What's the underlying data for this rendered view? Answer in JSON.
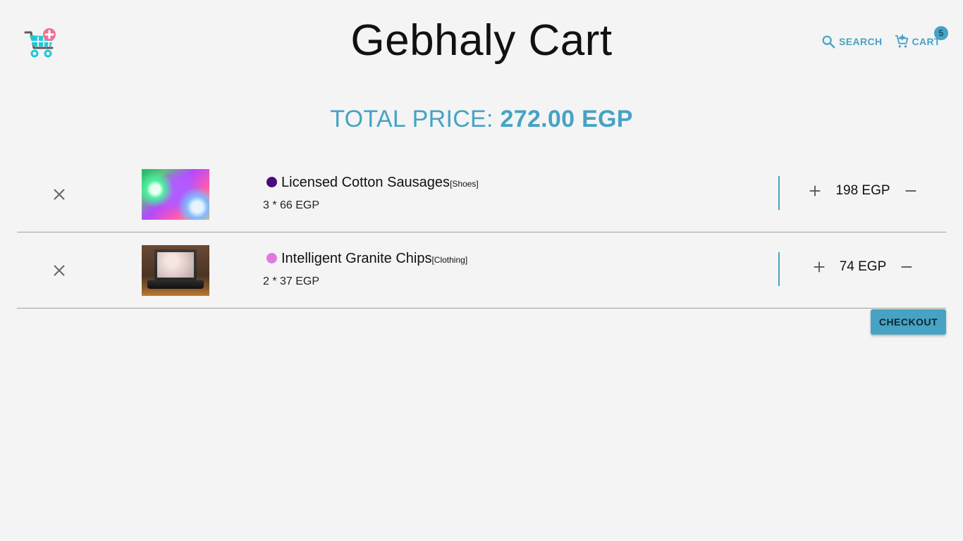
{
  "header": {
    "title": "Gebhaly Cart",
    "logo_icon": "shopping-cart-add-icon",
    "search_label": "SEARCH",
    "cart_label": "CART",
    "cart_count": "5"
  },
  "summary": {
    "total_label": "TOTAL PRICE:",
    "total_amount": "272.00 EGP"
  },
  "cart": {
    "items": [
      {
        "name": "Licensed Cotton Sausages",
        "category": "[Shoes]",
        "quantity_text": "3 * 66 EGP",
        "line_price": "198 EGP",
        "color": "#4b0a7a",
        "image_icon": "abstract-colorful-photo"
      },
      {
        "name": "Intelligent Granite Chips",
        "category": "[Clothing]",
        "quantity_text": "2 * 37 EGP",
        "line_price": "74 EGP",
        "color": "#e07ae0",
        "image_icon": "laptop-photo"
      }
    ]
  },
  "actions": {
    "checkout_label": "CHECKOUT"
  },
  "colors": {
    "accent": "#46a3c4",
    "background": "#f4f4f4"
  }
}
